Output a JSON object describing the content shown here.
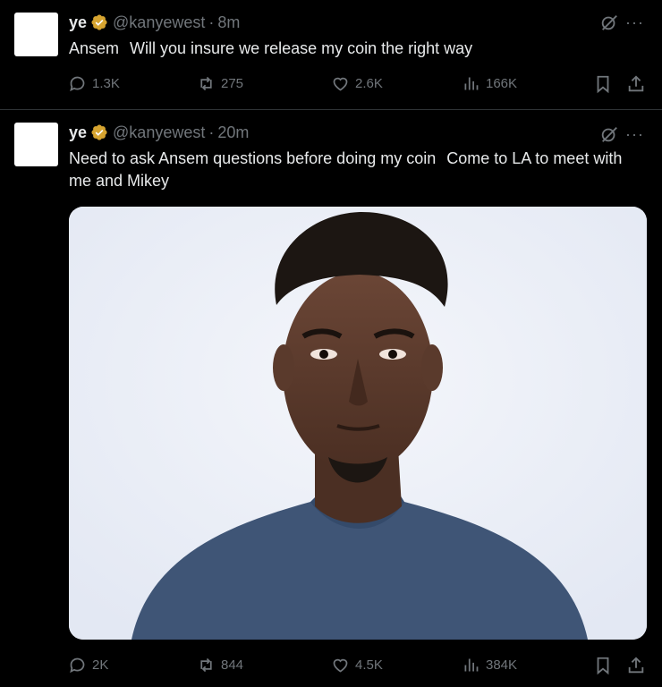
{
  "tweets": [
    {
      "author": {
        "name": "ye",
        "handle": "@kanyewest",
        "verified": true
      },
      "separator": "·",
      "time": "8m",
      "text_parts": [
        "Ansem",
        "Will you insure we release my coin the right way"
      ],
      "stats": {
        "replies": "1.3K",
        "reposts": "275",
        "likes": "2.6K",
        "views": "166K"
      }
    },
    {
      "author": {
        "name": "ye",
        "handle": "@kanyewest",
        "verified": true
      },
      "separator": "·",
      "time": "20m",
      "text_parts": [
        "Need to ask Ansem questions before doing my coin",
        "Come to LA to meet with me and Mikey"
      ],
      "has_media": true,
      "stats": {
        "replies": "2K",
        "reposts": "844",
        "likes": "4.5K",
        "views": "384K"
      }
    }
  ],
  "colors": {
    "background": "#000000",
    "text": "#e7e9ea",
    "muted": "#71767b",
    "divider": "#2f3336",
    "badge": "#d6a430"
  }
}
